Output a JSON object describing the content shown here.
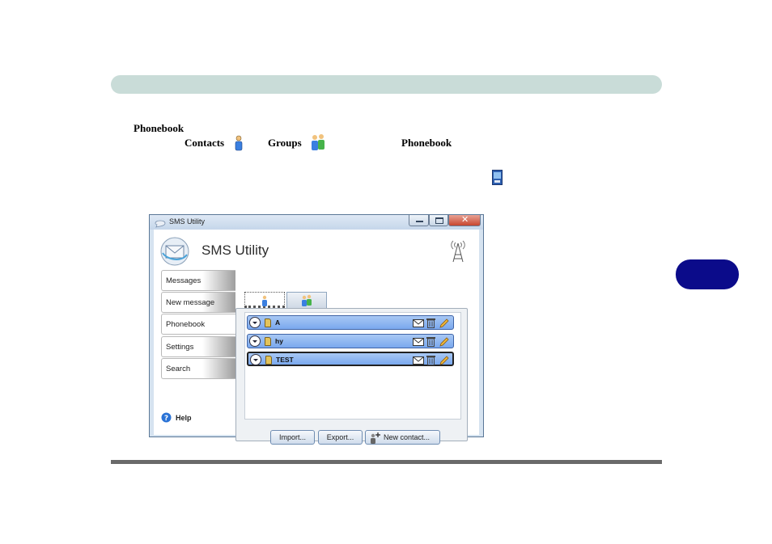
{
  "document": {
    "line1_bold": "Phonebook",
    "line2_contacts": "Contacts",
    "line2_groups": "Groups",
    "line2_phonebook": "Phonebook"
  },
  "colors": {
    "header_bar": "#c9dcd8",
    "chapter_tab": "#0b0b8a",
    "contact_row": "#7aa8ee"
  },
  "window": {
    "title": "SMS Utility",
    "app_title": "SMS Utility",
    "controls": [
      "minimize-icon",
      "maximize-icon",
      "close-icon"
    ],
    "signal_icon": "antenna-tower-icon",
    "nav": {
      "items": [
        {
          "label": "Messages",
          "active": false
        },
        {
          "label": "New message",
          "active": false
        },
        {
          "label": "Phonebook",
          "active": true
        },
        {
          "label": "Settings",
          "active": false
        },
        {
          "label": "Search",
          "active": false
        }
      ],
      "help_label": "Help"
    },
    "tabs": [
      {
        "icon": "contact-person-icon",
        "selected": true
      },
      {
        "icon": "group-people-icon",
        "selected": false
      }
    ],
    "contacts": [
      {
        "name": "A",
        "selected": false
      },
      {
        "name": "hy",
        "selected": false
      },
      {
        "name": "TEST",
        "selected": true
      }
    ],
    "row_actions": [
      "message-envelope-icon",
      "delete-trash-icon",
      "edit-pencil-icon"
    ],
    "buttons": {
      "import_label": "Import...",
      "export_label": "Export...",
      "new_contact_label": "New contact..."
    }
  }
}
